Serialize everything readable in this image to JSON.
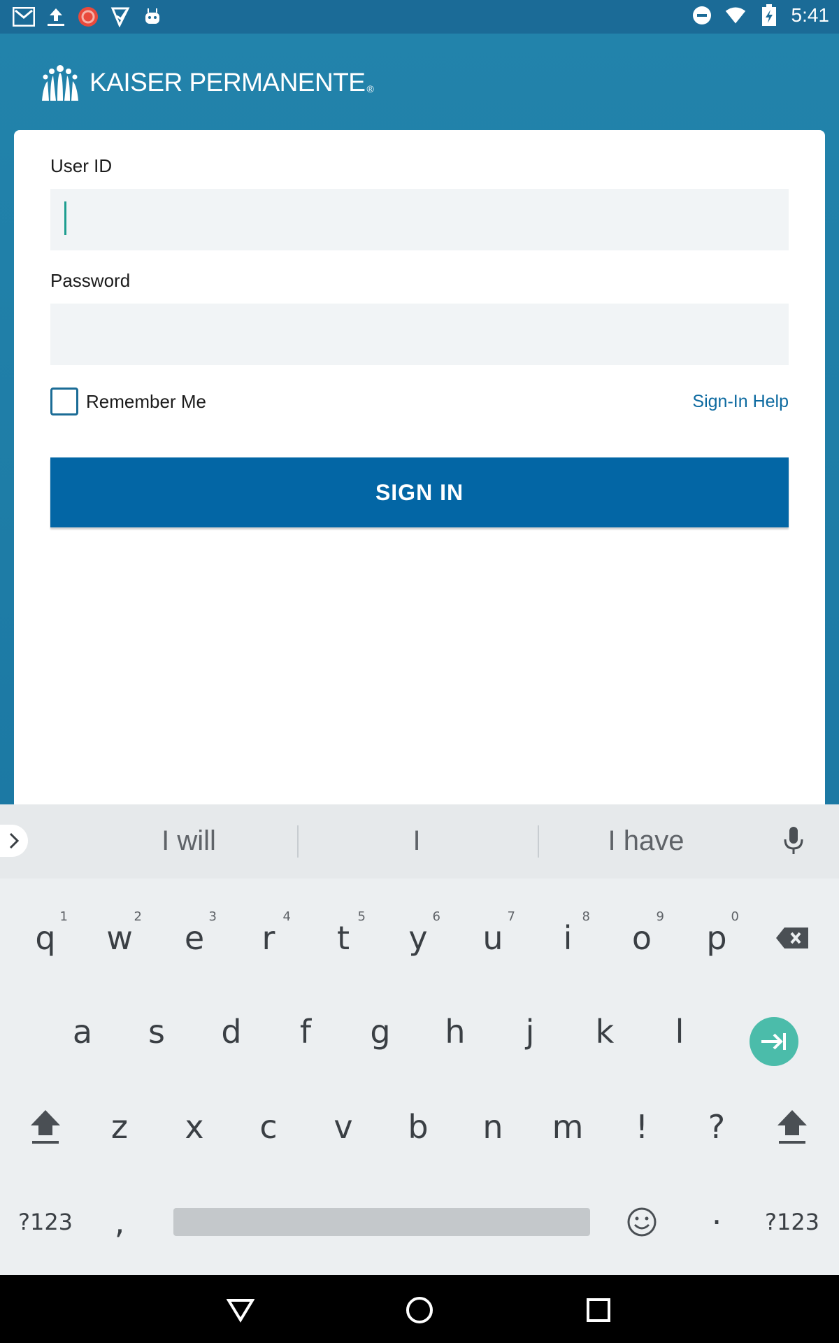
{
  "status_bar": {
    "time": "5:41",
    "left_icons": [
      "gmail-icon",
      "upload-icon",
      "app-badge-icon",
      "play-store-icon",
      "android-icon"
    ],
    "right_icons": [
      "do-not-disturb-icon",
      "wifi-icon",
      "battery-charging-icon"
    ]
  },
  "header": {
    "brand_name": "KAISER PERMANENTE",
    "brand_reg": "®"
  },
  "login": {
    "user_id_label": "User ID",
    "user_id_value": "",
    "password_label": "Password",
    "password_value": "",
    "remember_label": "Remember Me",
    "remember_checked": false,
    "help_link": "Sign-In Help",
    "signin_label": "SIGN IN"
  },
  "keyboard": {
    "suggestions": [
      "I will",
      "I",
      "I have"
    ],
    "row1": [
      {
        "key": "q",
        "hint": "1"
      },
      {
        "key": "w",
        "hint": "2"
      },
      {
        "key": "e",
        "hint": "3"
      },
      {
        "key": "r",
        "hint": "4"
      },
      {
        "key": "t",
        "hint": "5"
      },
      {
        "key": "y",
        "hint": "6"
      },
      {
        "key": "u",
        "hint": "7"
      },
      {
        "key": "i",
        "hint": "8"
      },
      {
        "key": "o",
        "hint": "9"
      },
      {
        "key": "p",
        "hint": "0"
      }
    ],
    "row2": [
      "a",
      "s",
      "d",
      "f",
      "g",
      "h",
      "j",
      "k",
      "l"
    ],
    "row3": [
      "z",
      "x",
      "c",
      "v",
      "b",
      "n",
      "m",
      "!",
      "?"
    ],
    "symbols_label": "?123",
    "comma": ",",
    "period": "·",
    "symbols_label_right": "?123"
  },
  "colors": {
    "header_bg": "#2283ab",
    "status_bar_bg": "#1b6b97",
    "signin_bg": "#0366a5",
    "link": "#0d6aa0",
    "enter_key": "#4bbcaa"
  },
  "nav_bar": {
    "icons": [
      "back-icon",
      "home-icon",
      "recents-icon"
    ]
  }
}
